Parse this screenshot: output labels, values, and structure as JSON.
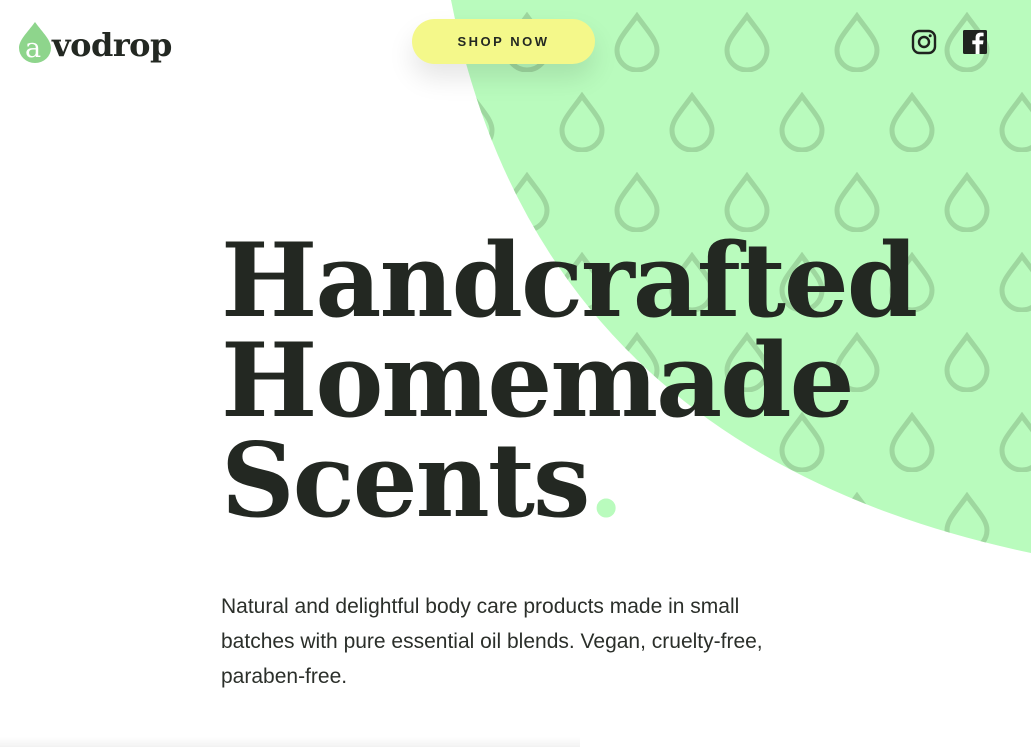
{
  "brand": {
    "logo_initial": "a",
    "logo_rest": "vodrop",
    "accent": "#b9fbbd",
    "drop_color": "#8ed58c"
  },
  "header": {
    "cta_label": "SHOP NOW",
    "cta_color": "#f4f88a",
    "social": [
      {
        "name": "instagram",
        "icon": "instagram-icon"
      },
      {
        "name": "facebook",
        "icon": "facebook-icon"
      }
    ]
  },
  "hero": {
    "headline_lines": [
      "Handcrafted",
      "Homemade",
      "Scents"
    ],
    "headline_period": ".",
    "description": "Natural and delightful body care products made in small batches with pure essential oil blends. Vegan, cruelty-free, paraben-free.",
    "background_color": "#b9fbbd",
    "pattern_icon": "water-drop-icon"
  }
}
